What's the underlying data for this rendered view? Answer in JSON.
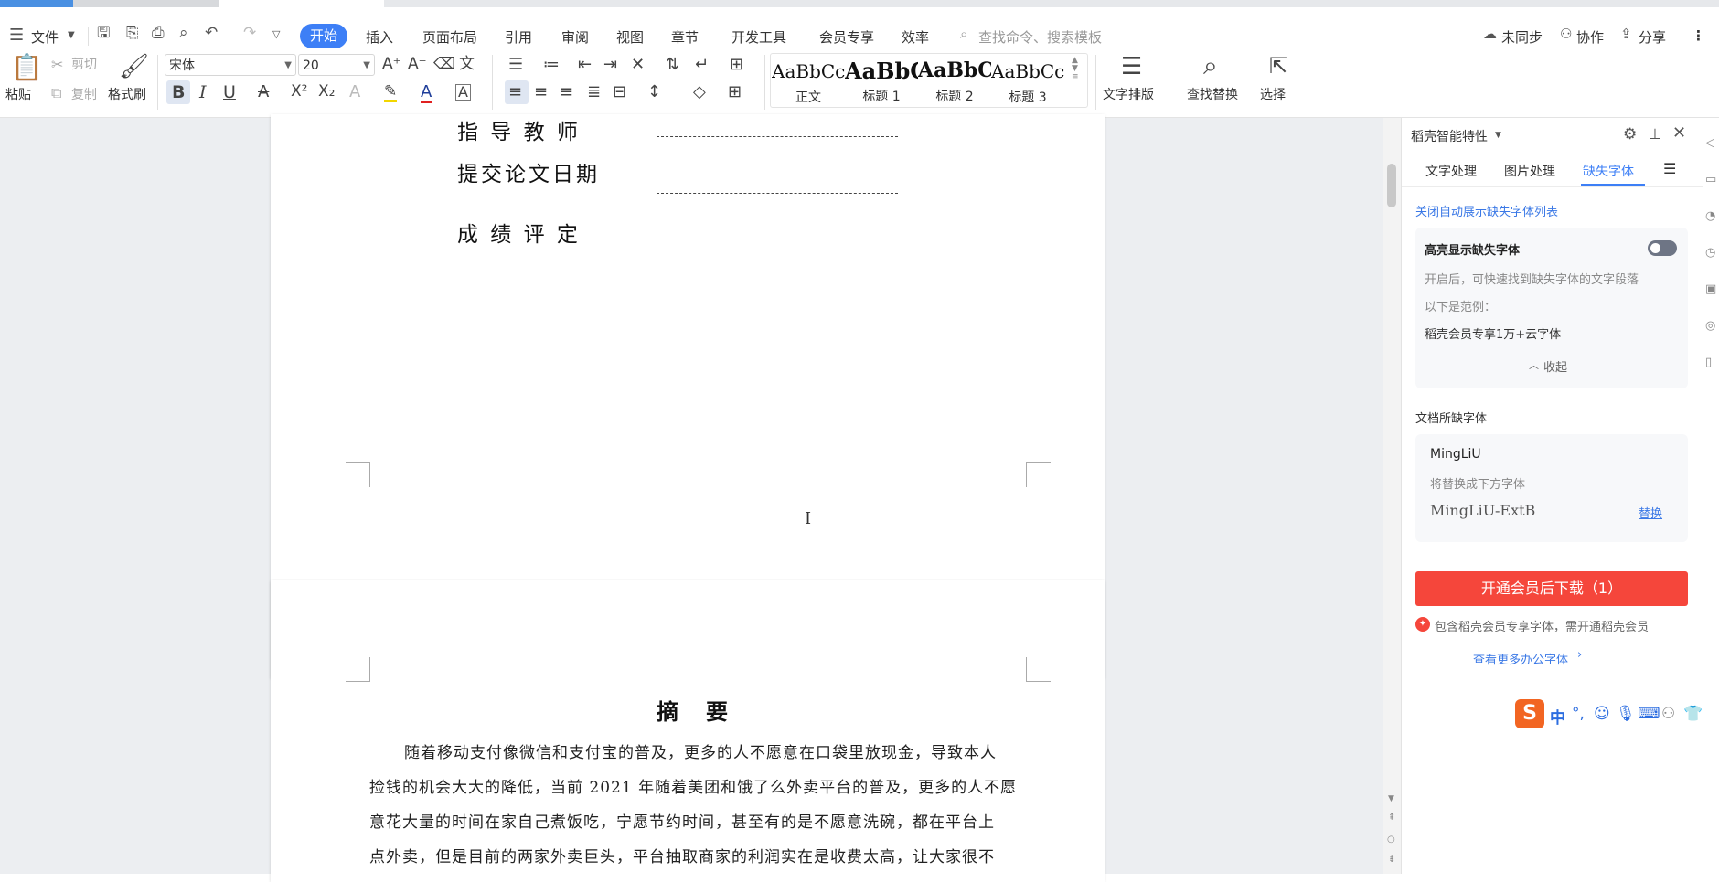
{
  "menu": {
    "file": "文件",
    "tabs": [
      "开始",
      "插入",
      "页面布局",
      "引用",
      "审阅",
      "视图",
      "章节",
      "开发工具",
      "会员专享",
      "效率"
    ],
    "search_placeholder": "查找命令、搜索模板",
    "sync": "未同步",
    "collab": "协作",
    "share": "分享"
  },
  "toolbar": {
    "paste": "粘贴",
    "cut": "剪切",
    "copy": "复制",
    "format_painter": "格式刷",
    "font_name": "宋体",
    "font_size": "20",
    "styles": [
      {
        "preview": "AaBbCcDd",
        "name": "正文"
      },
      {
        "preview": "AaBbC",
        "name": "标题 1"
      },
      {
        "preview": "AaBbC",
        "name": "标题 2"
      },
      {
        "preview": "AaBbCc",
        "name": "标题 3"
      }
    ],
    "text_layout": "文字排版",
    "find_replace": "查找替换",
    "select": "选择"
  },
  "document": {
    "fields": [
      {
        "label": "指 导 教 师"
      },
      {
        "label": "提交论文日期"
      },
      {
        "label": "成 绩 评 定"
      }
    ],
    "abstract_title": "摘　要",
    "abstract_lines": [
      "随着移动支付像微信和支付宝的普及，更多的人不愿意在口袋里放现金，导致本人",
      "捡钱的机会大大的降低，当前 2021 年随着美团和饿了么外卖平台的普及，更多的人不愿",
      "意花大量的时间在家自己煮饭吃，宁愿节约时间，甚至有的是不愿意洗碗，都在平台上",
      "点外卖，但是目前的两家外卖巨头，平台抽取商家的利润实在是收费太高，让大家很不"
    ]
  },
  "panel": {
    "title": "稻壳智能特性",
    "tabs": [
      "文字处理",
      "图片处理",
      "缺失字体"
    ],
    "active_tab": "缺失字体",
    "close_auto_link": "关闭自动展示缺失字体列表",
    "highlight_title": "高亮显示缺失字体",
    "highlight_desc": "开启后，可快速找到缺失字体的文字段落",
    "example_label": "以下是范例：",
    "example_text": "稻壳会员专享1万+云字体",
    "collapse": "收起",
    "missing_section": "文档所缺字体",
    "missing_font": "MingLiU",
    "replace_hint": "将替换成下方字体",
    "replacement_font": "MingLiU-ExtB",
    "replace_action": "替换",
    "download_button": "开通会员后下载（1）",
    "member_note": "包含稻壳会员专享字体，需开通稻壳会员",
    "more_fonts": "查看更多办公字体"
  },
  "ime": {
    "mode": "中"
  },
  "colors": {
    "accent": "#3d7ff6",
    "download": "#f5463b",
    "link": "#3a78e6"
  }
}
